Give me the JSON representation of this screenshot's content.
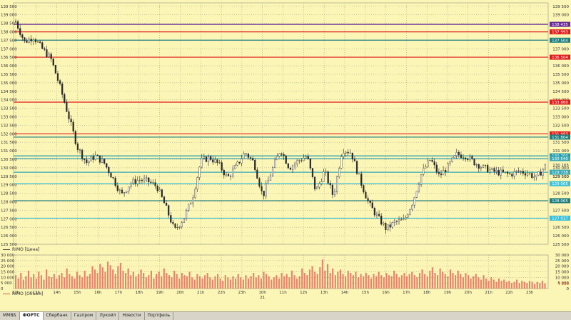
{
  "price_panel": {
    "series_label": "RIMO [Цена]",
    "y_ticks": [
      "139 500",
      "139 000",
      "138 500",
      "138 000",
      "137 500",
      "137 000",
      "136 500",
      "136 000",
      "135 500",
      "135 000",
      "134 500",
      "134 000",
      "133 500",
      "133 000",
      "132 500",
      "132 000",
      "131 500",
      "131 000",
      "130 500",
      "130 000",
      "129 500",
      "129 000",
      "128 500",
      "128 000",
      "127 500",
      "127 000",
      "126 500",
      "126 000",
      "125 500"
    ],
    "levels": [
      {
        "label": "138 435",
        "color": "#6a2a9a"
      },
      {
        "label": "137 993",
        "color": "#e21b1b"
      },
      {
        "label": "137 504",
        "color": "#1f7f7f"
      },
      {
        "label": "136 504",
        "color": "#e21b1b"
      },
      {
        "label": "133 860",
        "color": "#e21b1b"
      },
      {
        "label": "131 993",
        "color": "#e21b1b"
      },
      {
        "label": "131 804",
        "color": "#1f7f7f"
      },
      {
        "label": "130 700",
        "color": "#1f9aa8"
      },
      {
        "label": "130 540",
        "color": "#38a9b6"
      },
      {
        "label": "129 738",
        "color": "#38a9b6"
      },
      {
        "label": "129 065",
        "color": "#38c0d8"
      },
      {
        "label": "128 065",
        "color": "#1f7f7f"
      },
      {
        "label": "127 037",
        "color": "#38c0d8"
      }
    ],
    "extra_labels": [
      "130 165",
      "129 500"
    ],
    "top_cut": "139 500"
  },
  "volume_panel": {
    "series_label": "RIMO [Объем]",
    "y_ticks": [
      "30 000",
      "25 000",
      "20 000",
      "15 000",
      "10 000",
      "5 000",
      "0"
    ],
    "current_value": "4 596",
    "bar_color": "#e8836a"
  },
  "x_axis": {
    "labels": [
      "12h",
      "13h",
      "14h",
      "15h",
      "16h",
      "17h",
      "18h",
      "19h",
      "20h",
      "21h",
      "22h",
      "23h",
      "10h",
      "11h",
      "12h",
      "13h",
      "14h",
      "15h",
      "16h",
      "17h",
      "18h",
      "19h",
      "20h",
      "21h",
      "22h",
      "23h"
    ],
    "date_label": "21"
  },
  "chart_data": [
    {
      "type": "candlestick",
      "title": "",
      "series": [
        {
          "name": "RIMO [Цена]"
        }
      ],
      "x": [
        "12h",
        "13h",
        "14h",
        "15h",
        "16h",
        "17h",
        "18h",
        "19h",
        "20h",
        "21h",
        "22h",
        "23h",
        "10h",
        "11h",
        "12h",
        "13h",
        "14h",
        "15h",
        "16h",
        "17h",
        "18h",
        "19h",
        "20h",
        "21h",
        "22h",
        "23h"
      ],
      "close_path": [
        138600,
        137400,
        137700,
        137000,
        136400,
        134800,
        133000,
        131200,
        130300,
        130700,
        130300,
        129400,
        128400,
        129100,
        129300,
        129200,
        128900,
        127700,
        126300,
        127000,
        128200,
        130400,
        130600,
        130200,
        129400,
        130100,
        130900,
        130300,
        128300,
        129800,
        131100,
        130000,
        130400,
        130700,
        128600,
        129800,
        128300,
        131100,
        130900,
        129300,
        127900,
        127100,
        126400,
        126800,
        126900,
        128000,
        129700,
        130500,
        129500,
        130100,
        130800,
        130700,
        130300,
        130000,
        129800,
        129700,
        129600,
        129800,
        129700,
        129400,
        130100
      ],
      "ylim": [
        125500,
        139700
      ],
      "grid": true
    },
    {
      "type": "bar",
      "title": "",
      "series": [
        {
          "name": "RIMO [Объем]"
        }
      ],
      "values": [
        12000,
        9000,
        14000,
        8000,
        11000,
        16000,
        10000,
        13000,
        9000,
        15000,
        12000,
        8000,
        17000,
        11000,
        10000,
        13000,
        9000,
        12000,
        14000,
        10000,
        18000,
        13000,
        11000,
        9000,
        15000,
        12000,
        10000,
        16000,
        11000,
        13000,
        20000,
        17000,
        14000,
        22000,
        19000,
        15000,
        24000,
        21000,
        17000,
        13000,
        20000,
        23000,
        16000,
        14000,
        18000,
        12000,
        15000,
        11000,
        13000,
        17000,
        14000,
        10000,
        12000,
        16000,
        9000,
        13000,
        15000,
        11000,
        18000,
        14000,
        12000,
        10000,
        16000,
        13000,
        9000,
        14000,
        12000,
        11000,
        15000,
        10000,
        8000,
        13000,
        11000,
        9000,
        12000,
        14000,
        10000,
        8000,
        11000,
        13000,
        9000,
        7000,
        12000,
        10000,
        8000,
        11000,
        9000,
        13000,
        10000,
        8000,
        12000,
        9000,
        11000,
        14000,
        10000,
        12000,
        9000,
        15000,
        13000,
        11000,
        8000,
        10000,
        12000,
        9000,
        14000,
        11000,
        13000,
        10000,
        16000,
        12000,
        9000,
        11000,
        18000,
        14000,
        12000,
        17000,
        20000,
        15000,
        13000,
        19000,
        26000,
        16000,
        22000,
        14000,
        18000,
        12000,
        15000,
        17000,
        13000,
        11000,
        16000,
        14000,
        12000,
        15000,
        10000,
        13000,
        11000,
        14000,
        12000,
        9000,
        13000,
        11000,
        15000,
        12000,
        10000,
        14000,
        12000,
        11000,
        16000,
        13000,
        10000,
        12000,
        14000,
        11000,
        13000,
        15000,
        12000,
        10000,
        14000,
        17000,
        13000,
        11000,
        16000,
        19000,
        14000,
        12000,
        18000,
        15000,
        13000,
        11000,
        17000,
        14000,
        12000,
        16000,
        13000,
        10000,
        14000,
        12000,
        9000,
        11000,
        13000,
        10000,
        8000,
        12000,
        9000,
        7000,
        10000,
        8000,
        6000,
        9000,
        7000,
        8000,
        6000,
        7000,
        5000,
        6000,
        8000,
        5000,
        7000,
        6000,
        5000,
        7000,
        6000,
        4000,
        6000,
        5000,
        7000,
        4596
      ],
      "ylim": [
        0,
        30000
      ],
      "grid": true
    }
  ],
  "tabs": [
    {
      "label": "ММВБ",
      "active": false
    },
    {
      "label": "ФОРТС",
      "active": true
    },
    {
      "label": "Сбербанк",
      "active": false
    },
    {
      "label": "Газпром",
      "active": false
    },
    {
      "label": "Лукойл",
      "active": false
    },
    {
      "label": "Новости",
      "active": false
    },
    {
      "label": "Портфель",
      "active": false
    }
  ]
}
